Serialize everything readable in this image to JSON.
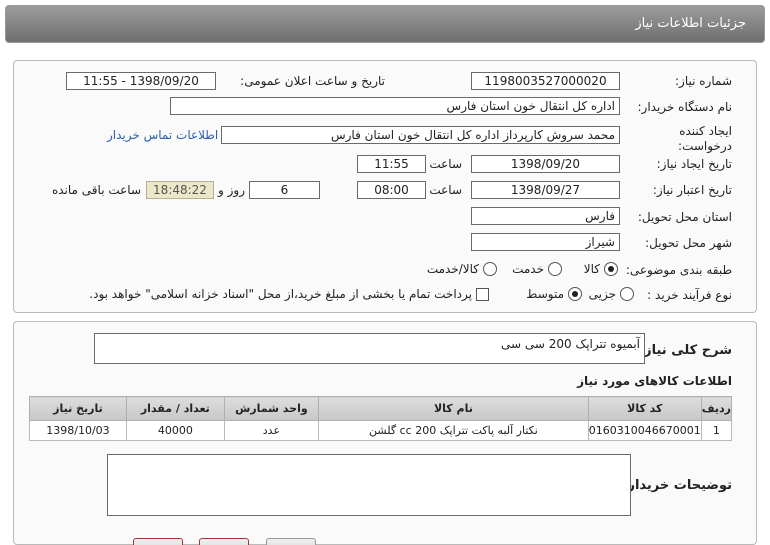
{
  "header": {
    "title": "جزئیات اطلاعات نیاز"
  },
  "form": {
    "need_number_label": "شماره نیاز:",
    "need_number": "1198003527000020",
    "announce_label": "تاریخ و ساعت اعلان عمومی:",
    "announce_value": "1398/09/20 - 11:55",
    "buyer_org_label": "نام دستگاه خریدار:",
    "buyer_org": "اداره کل انتقال خون استان فارس",
    "creator_label": "ایجاد کننده درخواست:",
    "creator": "محمد سروش کارپرداز اداره کل انتقال خون استان فارس",
    "contact_link": "اطلاعات تماس خریدار",
    "created_date_label": "تاریخ ایجاد نیاز:",
    "created_date": "1398/09/20",
    "time_label": "ساعت",
    "created_time": "11:55",
    "validity_label": "تاریخ اعتبار نیاز:",
    "validity_date": "1398/09/27",
    "validity_time": "08:00",
    "days_label": "روز و",
    "days": "6",
    "remaining": "18:48:22",
    "remaining_label": "ساعت باقی مانده",
    "province_label": "استان محل تحویل:",
    "province": "فارس",
    "city_label": "شهر محل تحویل:",
    "city": "شیراز",
    "category_label": "طبقه بندی موضوعی:",
    "category_options": [
      "کالا",
      "خدمت",
      "کالا/خدمت"
    ],
    "process_label": "نوع فرآیند خرید :",
    "process_options": [
      "جزیی",
      "متوسط"
    ],
    "payment_note": "پرداخت تمام یا بخشی از مبلغ خرید،از محل \"اسناد خزانه اسلامی\" خواهد بود."
  },
  "description": {
    "label": "شرح کلی نیاز:",
    "value": "آبمیوه تتراپک 200 سی سی"
  },
  "items": {
    "title": "اطلاعات کالاهای مورد نیاز",
    "headers": [
      "ردیف",
      "کد کالا",
      "نام کالا",
      "واحد شمارش",
      "تعداد / مقدار",
      "تاریخ نیاز"
    ],
    "rows": [
      [
        "1",
        "0160310046670001",
        "نکتار آلبه پاکت تتراپک 200 cc گلشن",
        "عدد",
        "40000",
        "1398/10/03"
      ]
    ]
  },
  "buyer_notes": {
    "label": "توضیحات خریدار:"
  }
}
